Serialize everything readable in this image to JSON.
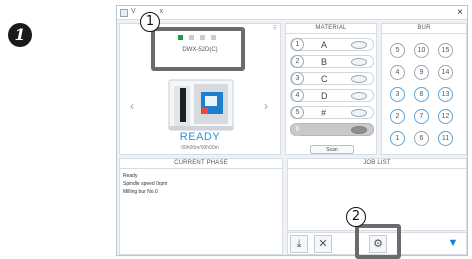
{
  "step": {
    "number": "1"
  },
  "window": {
    "title": "V",
    "title_suffix": "x",
    "close": "×"
  },
  "machine": {
    "corner_icon": "⠿",
    "model": "DWX-52D(C)",
    "status": "READY",
    "time": "00h00m/00h00m",
    "prev_arrow": "‹",
    "next_arrow": "›",
    "active_dot": 1,
    "dot_count": 4
  },
  "material": {
    "header": "MATERIAL",
    "rows": [
      {
        "num": "1",
        "letter": "A",
        "enabled": true
      },
      {
        "num": "2",
        "letter": "B",
        "enabled": true
      },
      {
        "num": "3",
        "letter": "C",
        "enabled": true
      },
      {
        "num": "4",
        "letter": "D",
        "enabled": true
      },
      {
        "num": "5",
        "letter": "#",
        "enabled": true
      },
      {
        "num": "6",
        "letter": "",
        "enabled": false
      }
    ],
    "scan_label": "Scan"
  },
  "bur": {
    "header": "BUR",
    "items": [
      {
        "num": "5",
        "color": "gray"
      },
      {
        "num": "10",
        "color": "gray"
      },
      {
        "num": "15",
        "color": "gray"
      },
      {
        "num": "4",
        "color": "gray"
      },
      {
        "num": "9",
        "color": "gray"
      },
      {
        "num": "14",
        "color": "gray"
      },
      {
        "num": "3",
        "color": "blue"
      },
      {
        "num": "8",
        "color": "blue"
      },
      {
        "num": "13",
        "color": "blue"
      },
      {
        "num": "2",
        "color": "blue"
      },
      {
        "num": "7",
        "color": "blue"
      },
      {
        "num": "12",
        "color": "blue"
      },
      {
        "num": "1",
        "color": "blue"
      },
      {
        "num": "6",
        "color": "gray"
      },
      {
        "num": "11",
        "color": "blue"
      }
    ]
  },
  "phase": {
    "header": "CURRENT PHASE",
    "lines": [
      "Ready",
      "Spindle speed   0rpm",
      "Milling bur   No.0"
    ]
  },
  "job": {
    "header": "JOB LIST"
  },
  "toolbar": {
    "buttons": [
      {
        "name": "import-job-button",
        "icon": "⤓"
      },
      {
        "name": "delete-job-button",
        "icon": "✕"
      },
      {
        "name": "settings-button",
        "icon": "⚙"
      },
      {
        "name": "vpanel-button",
        "icon": "▼"
      }
    ]
  },
  "callouts": {
    "one": "1",
    "two": "2"
  },
  "colors": {
    "accent": "#2f8fd6",
    "active_dot": "#1a9e3a",
    "callout": "#6b6b6b"
  }
}
